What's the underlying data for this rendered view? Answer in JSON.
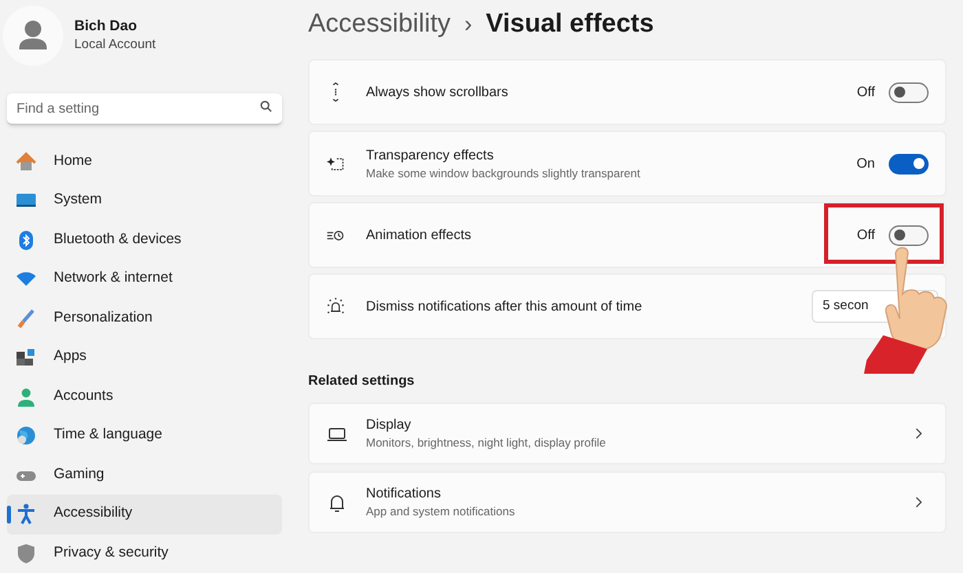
{
  "account": {
    "name": "Bich Dao",
    "type": "Local Account"
  },
  "search": {
    "placeholder": "Find a setting"
  },
  "nav": [
    {
      "label": "Home",
      "selected": false
    },
    {
      "label": "System",
      "selected": false
    },
    {
      "label": "Bluetooth & devices",
      "selected": false
    },
    {
      "label": "Network & internet",
      "selected": false
    },
    {
      "label": "Personalization",
      "selected": false
    },
    {
      "label": "Apps",
      "selected": false
    },
    {
      "label": "Accounts",
      "selected": false
    },
    {
      "label": "Time & language",
      "selected": false
    },
    {
      "label": "Gaming",
      "selected": false
    },
    {
      "label": "Accessibility",
      "selected": true
    },
    {
      "label": "Privacy & security",
      "selected": false
    }
  ],
  "breadcrumb": {
    "parent": "Accessibility",
    "separator": "›",
    "current": "Visual effects"
  },
  "settings": [
    {
      "kind": "toggle",
      "title": "Always show scrollbars",
      "state": "Off",
      "on": false
    },
    {
      "kind": "toggle",
      "title": "Transparency effects",
      "subtitle": "Make some window backgrounds slightly transparent",
      "state": "On",
      "on": true
    },
    {
      "kind": "toggle",
      "title": "Animation effects",
      "state": "Off",
      "on": false,
      "highlighted": true
    },
    {
      "kind": "dropdown",
      "title": "Dismiss notifications after this amount of time",
      "value": "5 secon"
    }
  ],
  "related": {
    "heading": "Related settings",
    "items": [
      {
        "title": "Display",
        "subtitle": "Monitors, brightness, night light, display profile"
      },
      {
        "title": "Notifications",
        "subtitle": "App and system notifications"
      }
    ]
  }
}
